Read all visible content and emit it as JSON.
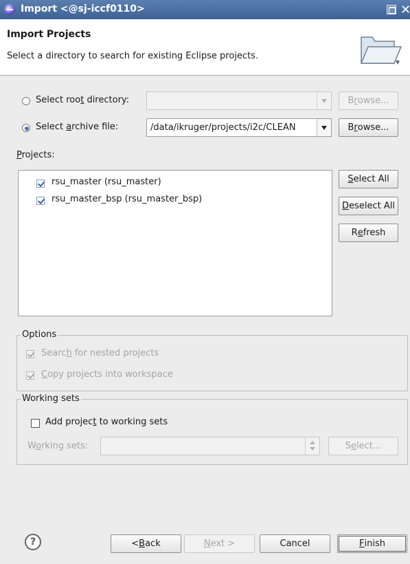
{
  "window": {
    "title": "Import <@sj-iccf0110>"
  },
  "header": {
    "title": "Import Projects",
    "description": "Select a directory to search for existing Eclipse projects."
  },
  "source": {
    "root_dir_pre": "Select roo",
    "root_dir_mn": "t",
    "root_dir_post": " directory:",
    "root_dir_value": "",
    "root_browse_pre": "B",
    "root_browse_mn": "r",
    "root_browse_post": "owse...",
    "archive_pre": "Select ",
    "archive_mn": "a",
    "archive_post": "rchive file:",
    "archive_value": "/data/ikruger/projects/i2c/CLEAN",
    "archive_browse_pre": "B",
    "archive_browse_mn": "r",
    "archive_browse_post": "owse..."
  },
  "projects": {
    "label_mn": "P",
    "label_post": "rojects:",
    "items": [
      {
        "label": "rsu_master (rsu_master)",
        "checked": true
      },
      {
        "label": "rsu_master_bsp (rsu_master_bsp)",
        "checked": true
      }
    ],
    "select_all_mn": "S",
    "select_all_post": "elect All",
    "deselect_all_mn": "D",
    "deselect_all_post": "eselect All",
    "refresh_pre": "R",
    "refresh_mn": "e",
    "refresh_post": "fresh"
  },
  "options": {
    "legend": "Options",
    "nested_pre": "Searc",
    "nested_mn": "h",
    "nested_post": " for nested projects",
    "copy_mn": "C",
    "copy_post": "opy projects into workspace"
  },
  "working_sets": {
    "legend": "Working sets",
    "add_pre": "Add projec",
    "add_mn": "t",
    "add_post": " to working sets",
    "sets_pre": "W",
    "sets_mn": "o",
    "sets_post": "rking sets:",
    "sets_value": "",
    "select_pre": "S",
    "select_mn": "e",
    "select_post": "lect..."
  },
  "footer": {
    "help_glyph": "?",
    "back_pre": "< ",
    "back_mn": "B",
    "back_post": "ack",
    "next_mn": "N",
    "next_post": "ext >",
    "cancel": "Cancel",
    "finish_mn": "F",
    "finish_post": "inish"
  },
  "colors": {
    "titlebar": "#4a6ea3",
    "radio_accent": "#4c79b7",
    "body_bg": "#ececec"
  }
}
